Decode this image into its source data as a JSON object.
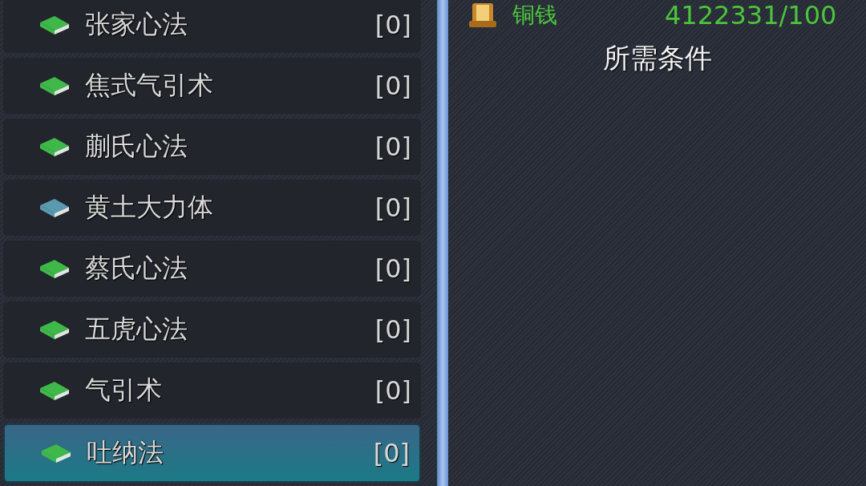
{
  "skills": [
    {
      "name": "张家心法",
      "count": "[0]",
      "color": "#3fb84a",
      "selected": false
    },
    {
      "name": "焦式气引术",
      "count": "[0]",
      "color": "#3fb84a",
      "selected": false
    },
    {
      "name": "蒯氏心法",
      "count": "[0]",
      "color": "#3fb84a",
      "selected": false
    },
    {
      "name": "黄土大力体",
      "count": "[0]",
      "color": "#5a9ab0",
      "selected": false
    },
    {
      "name": "蔡氏心法",
      "count": "[0]",
      "color": "#3fb84a",
      "selected": false
    },
    {
      "name": "五虎心法",
      "count": "[0]",
      "color": "#3fb84a",
      "selected": false
    },
    {
      "name": "气引术",
      "count": "[0]",
      "color": "#3fb84a",
      "selected": false
    },
    {
      "name": "吐纳法",
      "count": "[0]",
      "color": "#3fb84a",
      "selected": true
    }
  ],
  "cost": {
    "label": "铜钱",
    "value": "4122331/100"
  },
  "conditions_title": "所需条件"
}
